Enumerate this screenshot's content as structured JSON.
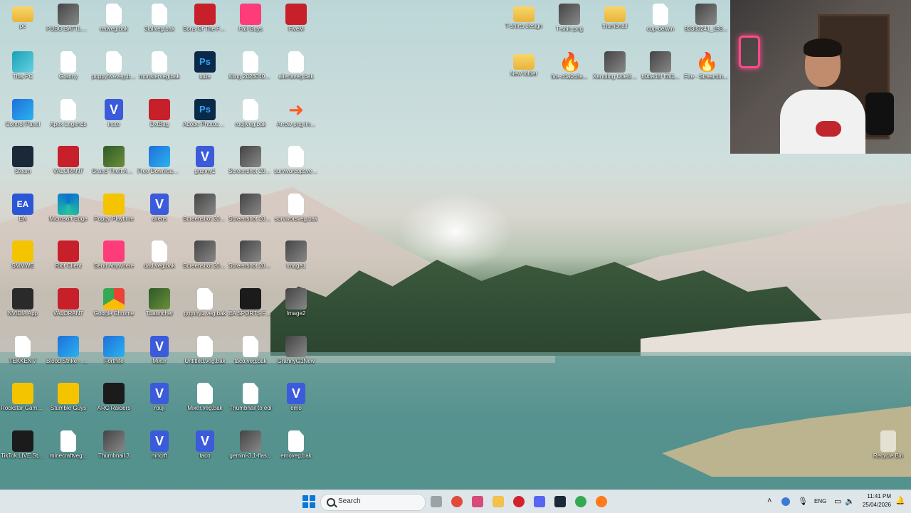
{
  "desktop_icons": [
    {
      "label": "pc",
      "type": "folder"
    },
    {
      "label": "PUBG BATTLEGROU...",
      "type": "pubg"
    },
    {
      "label": "redveg.bak",
      "type": "file"
    },
    {
      "label": "3lallveg.bak",
      "type": "file"
    },
    {
      "label": "Sons Of The Forest",
      "type": "sons"
    },
    {
      "label": "Fall Guys",
      "type": "fallguys"
    },
    {
      "label": "FiveM",
      "type": "fivem"
    },
    {
      "label": "This PC",
      "type": "thispc"
    },
    {
      "label": "Granny",
      "type": "file"
    },
    {
      "label": "poppyfiveveg.bak",
      "type": "file"
    },
    {
      "label": "monsterveg.bak",
      "type": "file"
    },
    {
      "label": "tube",
      "type": "ps"
    },
    {
      "label": "Kling 20260402 - Make the...",
      "type": "file"
    },
    {
      "label": "aliensveg.bak",
      "type": "file"
    },
    {
      "label": "Control Panel",
      "type": "control"
    },
    {
      "label": "Apex Legends",
      "type": "file"
    },
    {
      "label": "inste",
      "type": "v"
    },
    {
      "label": "DxtBag",
      "type": "dxt"
    },
    {
      "label": "Adobe Photoshop 2020",
      "type": "ps"
    },
    {
      "label": "roujiveg.bak",
      "type": "file"
    },
    {
      "label": "Arrow png im...",
      "type": "arrow"
    },
    {
      "label": "Steam",
      "type": "steam"
    },
    {
      "label": "VALORANT",
      "type": "valorant"
    },
    {
      "label": "Grand Theft Auto V Legacy",
      "type": "gta"
    },
    {
      "label": "Free Download Manager",
      "type": "fdm"
    },
    {
      "label": "grqnny1",
      "type": "v"
    },
    {
      "label": "Screenshot 2026-03-...",
      "type": "photo"
    },
    {
      "label": "survivorcopsveg...",
      "type": "file"
    },
    {
      "label": "EA",
      "type": "ea"
    },
    {
      "label": "Microsoft Edge",
      "type": "edge"
    },
    {
      "label": "Poppy Playtime",
      "type": "poppy"
    },
    {
      "label": "aliens",
      "type": "v"
    },
    {
      "label": "Screenshot 2026-02-...",
      "type": "photo"
    },
    {
      "label": "Screenshot 2026-03-...",
      "type": "photo"
    },
    {
      "label": "survivorsveg.bak",
      "type": "file"
    },
    {
      "label": "SMMWE",
      "type": "smmwe"
    },
    {
      "label": "Riot Client",
      "type": "riot"
    },
    {
      "label": "Send Anywhere",
      "type": "send"
    },
    {
      "label": "dad.veg.bak",
      "type": "file"
    },
    {
      "label": "Screenshot 2026-04-...",
      "type": "photo"
    },
    {
      "label": "Screenshot 2026-04-...",
      "type": "photo"
    },
    {
      "label": "Image1",
      "type": "photo"
    },
    {
      "label": "NVIDIA App",
      "type": "nvidia"
    },
    {
      "label": "VALORANT",
      "type": "riot"
    },
    {
      "label": "Google Chrome",
      "type": "chrome"
    },
    {
      "label": "TLauncher",
      "type": "tlauncher"
    },
    {
      "label": "grqnny1.veg.bak",
      "type": "file"
    },
    {
      "label": "EA SPORTS FC™ 26",
      "type": "fc"
    },
    {
      "label": "Image2",
      "type": "photo"
    },
    {
      "label": "TEKKEN 7",
      "type": "file"
    },
    {
      "label": "Blood Strike - MENA",
      "type": "bloodstrike"
    },
    {
      "label": "Fortnite",
      "type": "fortnite"
    },
    {
      "label": "Mixer",
      "type": "v"
    },
    {
      "label": "Untitled.veg.bak",
      "type": "file"
    },
    {
      "label": "taco.veg.bak",
      "type": "file"
    },
    {
      "label": "GrannyG1New",
      "type": "photo"
    },
    {
      "label": "Rockstar Games Launcher",
      "type": "rockstar"
    },
    {
      "label": "Stumble Guys",
      "type": "stumble"
    },
    {
      "label": "ARC Raiders",
      "type": "arc"
    },
    {
      "label": "rouji",
      "type": "v"
    },
    {
      "label": "Mixer.veg.bak",
      "type": "file"
    },
    {
      "label": "Thumbnail to edi",
      "type": "file"
    },
    {
      "label": "emo",
      "type": "v"
    },
    {
      "label": "TikTok LIVE Studio",
      "type": "tiktok"
    },
    {
      "label": "minecraftveg...",
      "type": "file"
    },
    {
      "label": "Thumbnail 3",
      "type": "photo"
    },
    {
      "label": "mncrft",
      "type": "v"
    },
    {
      "label": "taco",
      "type": "v"
    },
    {
      "label": "gemini-3.1-flas...",
      "type": "photo"
    },
    {
      "label": "emoveg.bak",
      "type": "file"
    },
    {
      "label": "T-shirts design",
      "type": "folder"
    },
    {
      "label": "T-shirt png",
      "type": "photo"
    },
    {
      "label": "thumbnail",
      "type": "folder"
    },
    {
      "label": "cup-delwin",
      "type": "file"
    },
    {
      "label": "83383241_193...",
      "type": "photo"
    },
    {
      "label": "New folder",
      "type": "folder"
    },
    {
      "label": "fire-c4a0c8e...",
      "type": "fire"
    },
    {
      "label": "Xenoling Udeltio...",
      "type": "photo"
    },
    {
      "label": "b0ba48f ff8f1...",
      "type": "photo"
    },
    {
      "label": "Fire - Streamlin...",
      "type": "fire"
    },
    {
      "label": "Recycle Bin",
      "type": "recycle"
    }
  ],
  "taskbar": {
    "search_placeholder": "Search",
    "apps": [
      "file-explorer-icon",
      "chrome-icon",
      "snipping-tool-icon",
      "folder-icon",
      "opera-icon",
      "discord-icon",
      "steam-icon",
      "chrome-icon",
      "firefox-icon"
    ],
    "language": "ENG",
    "time": "11:41 PM",
    "date": "25/04/2026"
  }
}
